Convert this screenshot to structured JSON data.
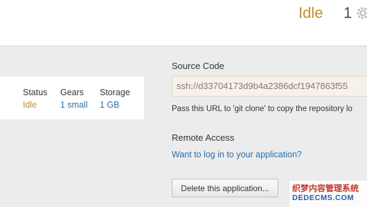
{
  "header": {
    "status": "Idle",
    "count": "1",
    "icon": "gear-icon"
  },
  "info": {
    "status_label": "Status",
    "status_value": "Idle",
    "gears_label": "Gears",
    "gears_value": "1 small",
    "storage_label": "Storage",
    "storage_value": "1 GB"
  },
  "source_code": {
    "title": "Source Code",
    "url": "ssh://d33704173d9b4a2386dcf1947863f55",
    "help": "Pass this URL to 'git clone' to copy the repository lo"
  },
  "remote_access": {
    "title": "Remote Access",
    "link": "Want to log in to your application?"
  },
  "actions": {
    "delete_label": "Delete this application..."
  },
  "watermark": {
    "line1": "织梦内容管理系统",
    "line2": "DEDECMS.COM"
  },
  "colors": {
    "idle": "#c98a2b",
    "link": "#2a6fa8"
  }
}
